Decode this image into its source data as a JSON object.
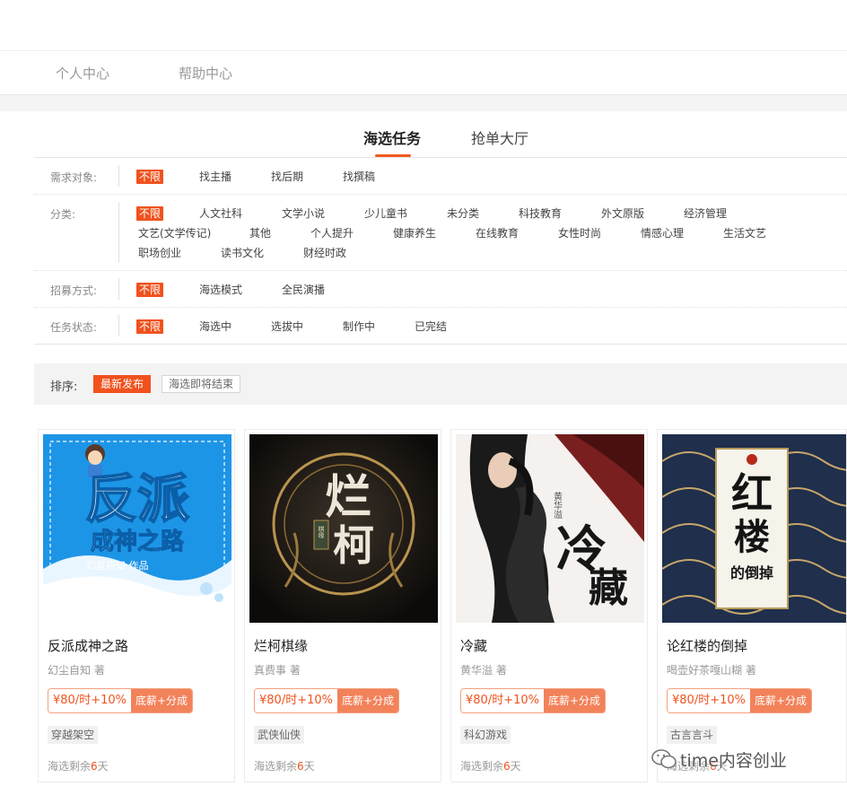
{
  "nav": {
    "items": [
      "个人中心",
      "帮助中心"
    ]
  },
  "tabs": [
    {
      "label": "海选任务",
      "active": true
    },
    {
      "label": "抢单大厅",
      "active": false
    }
  ],
  "filters": {
    "target": {
      "label": "需求对象:",
      "options": [
        "不限",
        "找主播",
        "找后期",
        "找撰稿"
      ]
    },
    "category": {
      "label": "分类:",
      "options": [
        "不限",
        "人文社科",
        "文学小说",
        "少儿童书",
        "未分类",
        "科技教育",
        "外文原版",
        "经济管理",
        "文艺(文学传记)",
        "其他",
        "个人提升",
        "健康养生",
        "在线教育",
        "女性时尚",
        "情感心理",
        "生活文艺",
        "职场创业",
        "读书文化",
        "财经时政"
      ]
    },
    "recruit": {
      "label": "招募方式:",
      "options": [
        "不限",
        "海选模式",
        "全民演播"
      ]
    },
    "status": {
      "label": "任务状态:",
      "options": [
        "不限",
        "海选中",
        "选拔中",
        "制作中",
        "已完结"
      ]
    }
  },
  "sort": {
    "label": "排序:",
    "options": [
      "最新发布",
      "海选即将结束"
    ]
  },
  "cards": [
    {
      "title": "反派成神之路",
      "author": "幻尘自知 著",
      "price": "¥80/时+10%",
      "price_type": "底薪+分成",
      "tag": "穿越架空",
      "remain_prefix": "海选剩余",
      "remain_days": "6",
      "remain_suffix": "天",
      "cover_text": [
        "反派",
        "成神之路",
        "幻星自知 作品"
      ]
    },
    {
      "title": "烂柯棋缘",
      "author": "真费事 著",
      "price": "¥80/时+10%",
      "price_type": "底薪+分成",
      "tag": "武侠仙侠",
      "remain_prefix": "海选剩余",
      "remain_days": "6",
      "remain_suffix": "天",
      "cover_text": [
        "烂",
        "柯",
        "棋缘"
      ]
    },
    {
      "title": "冷藏",
      "author": "黄华溢 著",
      "price": "¥80/时+10%",
      "price_type": "底薪+分成",
      "tag": "科幻游戏",
      "remain_prefix": "海选剩余",
      "remain_days": "6",
      "remain_suffix": "天",
      "cover_text": [
        "冷",
        "藏",
        "黄华溢"
      ]
    },
    {
      "title": "论红楼的倒掉",
      "author": "喝壶好茶嘎山糊 著",
      "price": "¥80/时+10%",
      "price_type": "底薪+分成",
      "tag": "古言言斗",
      "remain_prefix": "海选剩余",
      "remain_days": "6",
      "remain_suffix": "天",
      "cover_text": [
        "红",
        "楼",
        "的倒掉"
      ]
    }
  ],
  "watermark": "time内容创业",
  "colors": {
    "accent": "#f0521e",
    "accent_light": "#f2825a"
  }
}
